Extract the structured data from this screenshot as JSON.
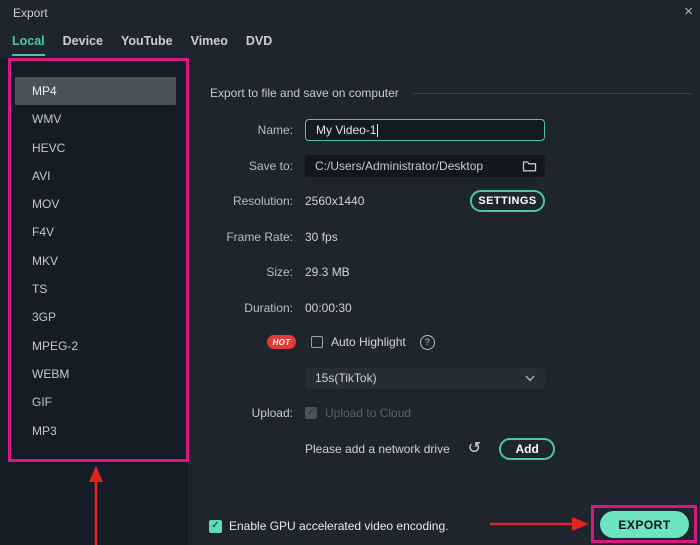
{
  "window": {
    "title": "Export"
  },
  "tabs": [
    {
      "label": "Local",
      "active": true
    },
    {
      "label": "Device",
      "active": false
    },
    {
      "label": "YouTube",
      "active": false
    },
    {
      "label": "Vimeo",
      "active": false
    },
    {
      "label": "DVD",
      "active": false
    }
  ],
  "sidebar": {
    "formats": [
      "MP4",
      "WMV",
      "HEVC",
      "AVI",
      "MOV",
      "F4V",
      "MKV",
      "TS",
      "3GP",
      "MPEG-2",
      "WEBM",
      "GIF",
      "MP3"
    ],
    "selected": "MP4"
  },
  "panel": {
    "section_title": "Export to file and save on computer",
    "name": {
      "label": "Name:",
      "value": "My Video-1"
    },
    "save_to": {
      "label": "Save to:",
      "value": "C:/Users/Administrator/Desktop"
    },
    "resolution": {
      "label": "Resolution:",
      "value": "2560x1440",
      "button": "SETTINGS"
    },
    "frame_rate": {
      "label": "Frame Rate:",
      "value": "30 fps"
    },
    "size": {
      "label": "Size:",
      "value": "29.3 MB"
    },
    "duration": {
      "label": "Duration:",
      "value": "00:00:30"
    },
    "auto_highlight": {
      "badge": "HOT",
      "label": "Auto Highlight",
      "checked": false
    },
    "preset": {
      "value": "15s(TikTok)"
    },
    "upload": {
      "label": "Upload:",
      "checkbox_label": "Upload to Cloud",
      "checked": true,
      "disabled": true
    },
    "network": {
      "message": "Please add a network drive",
      "button": "Add"
    }
  },
  "footer": {
    "gpu_label": "Enable GPU accelerated video encoding.",
    "gpu_checked": true,
    "export_button": "EXPORT"
  },
  "icons": {
    "close": "×",
    "help": "?",
    "check": "✓",
    "refresh": "↺"
  },
  "colors": {
    "accent_teal": "#4dc7a0",
    "export_button_bg": "#6ce4c2",
    "annotation_pink": "#d6187f",
    "annotation_arrow_red": "#e02420",
    "hot_badge_red": "#e03b38",
    "selected_item_bg": "#4a525c",
    "background": "#1e252e",
    "sidebar_background": "#161c25"
  }
}
